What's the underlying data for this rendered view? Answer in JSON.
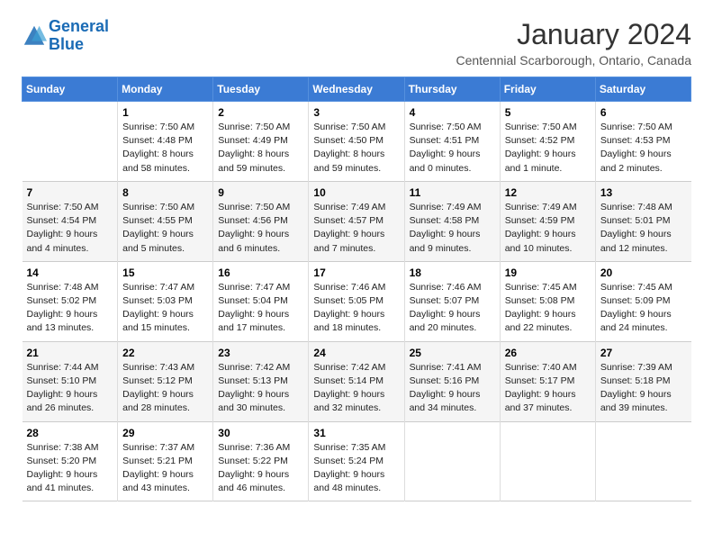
{
  "logo": {
    "text_general": "General",
    "text_blue": "Blue"
  },
  "header": {
    "title": "January 2024",
    "subtitle": "Centennial Scarborough, Ontario, Canada"
  },
  "days_of_week": [
    "Sunday",
    "Monday",
    "Tuesday",
    "Wednesday",
    "Thursday",
    "Friday",
    "Saturday"
  ],
  "weeks": [
    [
      {
        "day": "",
        "sunrise": "",
        "sunset": "",
        "daylight": ""
      },
      {
        "day": "1",
        "sunrise": "Sunrise: 7:50 AM",
        "sunset": "Sunset: 4:48 PM",
        "daylight": "Daylight: 8 hours and 58 minutes."
      },
      {
        "day": "2",
        "sunrise": "Sunrise: 7:50 AM",
        "sunset": "Sunset: 4:49 PM",
        "daylight": "Daylight: 8 hours and 59 minutes."
      },
      {
        "day": "3",
        "sunrise": "Sunrise: 7:50 AM",
        "sunset": "Sunset: 4:50 PM",
        "daylight": "Daylight: 8 hours and 59 minutes."
      },
      {
        "day": "4",
        "sunrise": "Sunrise: 7:50 AM",
        "sunset": "Sunset: 4:51 PM",
        "daylight": "Daylight: 9 hours and 0 minutes."
      },
      {
        "day": "5",
        "sunrise": "Sunrise: 7:50 AM",
        "sunset": "Sunset: 4:52 PM",
        "daylight": "Daylight: 9 hours and 1 minute."
      },
      {
        "day": "6",
        "sunrise": "Sunrise: 7:50 AM",
        "sunset": "Sunset: 4:53 PM",
        "daylight": "Daylight: 9 hours and 2 minutes."
      }
    ],
    [
      {
        "day": "7",
        "sunrise": "Sunrise: 7:50 AM",
        "sunset": "Sunset: 4:54 PM",
        "daylight": "Daylight: 9 hours and 4 minutes."
      },
      {
        "day": "8",
        "sunrise": "Sunrise: 7:50 AM",
        "sunset": "Sunset: 4:55 PM",
        "daylight": "Daylight: 9 hours and 5 minutes."
      },
      {
        "day": "9",
        "sunrise": "Sunrise: 7:50 AM",
        "sunset": "Sunset: 4:56 PM",
        "daylight": "Daylight: 9 hours and 6 minutes."
      },
      {
        "day": "10",
        "sunrise": "Sunrise: 7:49 AM",
        "sunset": "Sunset: 4:57 PM",
        "daylight": "Daylight: 9 hours and 7 minutes."
      },
      {
        "day": "11",
        "sunrise": "Sunrise: 7:49 AM",
        "sunset": "Sunset: 4:58 PM",
        "daylight": "Daylight: 9 hours and 9 minutes."
      },
      {
        "day": "12",
        "sunrise": "Sunrise: 7:49 AM",
        "sunset": "Sunset: 4:59 PM",
        "daylight": "Daylight: 9 hours and 10 minutes."
      },
      {
        "day": "13",
        "sunrise": "Sunrise: 7:48 AM",
        "sunset": "Sunset: 5:01 PM",
        "daylight": "Daylight: 9 hours and 12 minutes."
      }
    ],
    [
      {
        "day": "14",
        "sunrise": "Sunrise: 7:48 AM",
        "sunset": "Sunset: 5:02 PM",
        "daylight": "Daylight: 9 hours and 13 minutes."
      },
      {
        "day": "15",
        "sunrise": "Sunrise: 7:47 AM",
        "sunset": "Sunset: 5:03 PM",
        "daylight": "Daylight: 9 hours and 15 minutes."
      },
      {
        "day": "16",
        "sunrise": "Sunrise: 7:47 AM",
        "sunset": "Sunset: 5:04 PM",
        "daylight": "Daylight: 9 hours and 17 minutes."
      },
      {
        "day": "17",
        "sunrise": "Sunrise: 7:46 AM",
        "sunset": "Sunset: 5:05 PM",
        "daylight": "Daylight: 9 hours and 18 minutes."
      },
      {
        "day": "18",
        "sunrise": "Sunrise: 7:46 AM",
        "sunset": "Sunset: 5:07 PM",
        "daylight": "Daylight: 9 hours and 20 minutes."
      },
      {
        "day": "19",
        "sunrise": "Sunrise: 7:45 AM",
        "sunset": "Sunset: 5:08 PM",
        "daylight": "Daylight: 9 hours and 22 minutes."
      },
      {
        "day": "20",
        "sunrise": "Sunrise: 7:45 AM",
        "sunset": "Sunset: 5:09 PM",
        "daylight": "Daylight: 9 hours and 24 minutes."
      }
    ],
    [
      {
        "day": "21",
        "sunrise": "Sunrise: 7:44 AM",
        "sunset": "Sunset: 5:10 PM",
        "daylight": "Daylight: 9 hours and 26 minutes."
      },
      {
        "day": "22",
        "sunrise": "Sunrise: 7:43 AM",
        "sunset": "Sunset: 5:12 PM",
        "daylight": "Daylight: 9 hours and 28 minutes."
      },
      {
        "day": "23",
        "sunrise": "Sunrise: 7:42 AM",
        "sunset": "Sunset: 5:13 PM",
        "daylight": "Daylight: 9 hours and 30 minutes."
      },
      {
        "day": "24",
        "sunrise": "Sunrise: 7:42 AM",
        "sunset": "Sunset: 5:14 PM",
        "daylight": "Daylight: 9 hours and 32 minutes."
      },
      {
        "day": "25",
        "sunrise": "Sunrise: 7:41 AM",
        "sunset": "Sunset: 5:16 PM",
        "daylight": "Daylight: 9 hours and 34 minutes."
      },
      {
        "day": "26",
        "sunrise": "Sunrise: 7:40 AM",
        "sunset": "Sunset: 5:17 PM",
        "daylight": "Daylight: 9 hours and 37 minutes."
      },
      {
        "day": "27",
        "sunrise": "Sunrise: 7:39 AM",
        "sunset": "Sunset: 5:18 PM",
        "daylight": "Daylight: 9 hours and 39 minutes."
      }
    ],
    [
      {
        "day": "28",
        "sunrise": "Sunrise: 7:38 AM",
        "sunset": "Sunset: 5:20 PM",
        "daylight": "Daylight: 9 hours and 41 minutes."
      },
      {
        "day": "29",
        "sunrise": "Sunrise: 7:37 AM",
        "sunset": "Sunset: 5:21 PM",
        "daylight": "Daylight: 9 hours and 43 minutes."
      },
      {
        "day": "30",
        "sunrise": "Sunrise: 7:36 AM",
        "sunset": "Sunset: 5:22 PM",
        "daylight": "Daylight: 9 hours and 46 minutes."
      },
      {
        "day": "31",
        "sunrise": "Sunrise: 7:35 AM",
        "sunset": "Sunset: 5:24 PM",
        "daylight": "Daylight: 9 hours and 48 minutes."
      },
      {
        "day": "",
        "sunrise": "",
        "sunset": "",
        "daylight": ""
      },
      {
        "day": "",
        "sunrise": "",
        "sunset": "",
        "daylight": ""
      },
      {
        "day": "",
        "sunrise": "",
        "sunset": "",
        "daylight": ""
      }
    ]
  ]
}
